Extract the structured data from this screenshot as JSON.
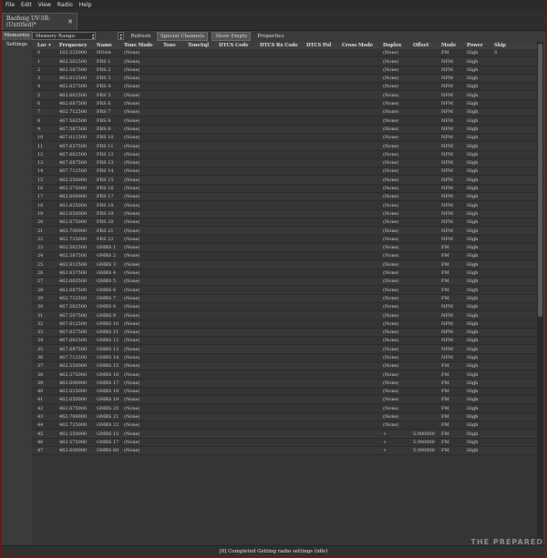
{
  "menu": [
    "File",
    "Edit",
    "View",
    "Radio",
    "Help"
  ],
  "doc_tab": {
    "title": "Baofeng UV-5R: (Untitled)*",
    "close": "✕"
  },
  "side_tabs": [
    "Memories",
    "Settings"
  ],
  "toolbar": {
    "memory_range": "Memory Range:",
    "refresh": "Refresh",
    "special_channels": "Special Channels",
    "show_empty": "Show Empty",
    "properties": "Properties"
  },
  "columns": [
    "Loc ▾",
    "Frequency",
    "Name",
    "Tone Mode",
    "Tone",
    "ToneSql",
    "DTCS Code",
    "DTCS Rx Code",
    "DTCS Pol",
    "Cross Mode",
    "Duplex",
    "Offset",
    "Mode",
    "Power",
    "Skip"
  ],
  "rows": [
    [
      "0",
      "162.525000",
      "NOAA",
      "(None)",
      "",
      "",
      "",
      "",
      "",
      "",
      "(None)",
      "",
      "FM",
      "High",
      "S"
    ],
    [
      "1",
      "462.562500",
      "FRS 1",
      "(None)",
      "",
      "",
      "",
      "",
      "",
      "",
      "(None)",
      "",
      "NFM",
      "High",
      ""
    ],
    [
      "2",
      "462.587500",
      "FRS 2",
      "(None)",
      "",
      "",
      "",
      "",
      "",
      "",
      "(None)",
      "",
      "NFM",
      "High",
      ""
    ],
    [
      "3",
      "462.612500",
      "FRS 3",
      "(None)",
      "",
      "",
      "",
      "",
      "",
      "",
      "(None)",
      "",
      "NFM",
      "High",
      ""
    ],
    [
      "4",
      "462.637500",
      "FRS 4",
      "(None)",
      "",
      "",
      "",
      "",
      "",
      "",
      "(None)",
      "",
      "NFM",
      "High",
      ""
    ],
    [
      "5",
      "462.662500",
      "FRS 5",
      "(None)",
      "",
      "",
      "",
      "",
      "",
      "",
      "(None)",
      "",
      "NFM",
      "High",
      ""
    ],
    [
      "6",
      "462.687500",
      "FRS 6",
      "(None)",
      "",
      "",
      "",
      "",
      "",
      "",
      "(None)",
      "",
      "NFM",
      "High",
      ""
    ],
    [
      "7",
      "462.712500",
      "FRS 7",
      "(None)",
      "",
      "",
      "",
      "",
      "",
      "",
      "(None)",
      "",
      "NFM",
      "High",
      ""
    ],
    [
      "8",
      "467.562500",
      "FRS 8",
      "(None)",
      "",
      "",
      "",
      "",
      "",
      "",
      "(None)",
      "",
      "NFM",
      "High",
      ""
    ],
    [
      "9",
      "467.587500",
      "FRS 9",
      "(None)",
      "",
      "",
      "",
      "",
      "",
      "",
      "(None)",
      "",
      "NFM",
      "High",
      ""
    ],
    [
      "10",
      "467.612500",
      "FRS 10",
      "(None)",
      "",
      "",
      "",
      "",
      "",
      "",
      "(None)",
      "",
      "NFM",
      "High",
      ""
    ],
    [
      "11",
      "467.637500",
      "FRS 11",
      "(None)",
      "",
      "",
      "",
      "",
      "",
      "",
      "(None)",
      "",
      "NFM",
      "High",
      ""
    ],
    [
      "12",
      "467.662500",
      "FRS 12",
      "(None)",
      "",
      "",
      "",
      "",
      "",
      "",
      "(None)",
      "",
      "NFM",
      "High",
      ""
    ],
    [
      "13",
      "467.687500",
      "FRS 13",
      "(None)",
      "",
      "",
      "",
      "",
      "",
      "",
      "(None)",
      "",
      "NFM",
      "High",
      ""
    ],
    [
      "14",
      "467.712500",
      "FRS 14",
      "(None)",
      "",
      "",
      "",
      "",
      "",
      "",
      "(None)",
      "",
      "NFM",
      "High",
      ""
    ],
    [
      "15",
      "462.550000",
      "FRS 15",
      "(None)",
      "",
      "",
      "",
      "",
      "",
      "",
      "(None)",
      "",
      "NFM",
      "High",
      ""
    ],
    [
      "16",
      "462.575000",
      "FRS 16",
      "(None)",
      "",
      "",
      "",
      "",
      "",
      "",
      "(None)",
      "",
      "NFM",
      "High",
      ""
    ],
    [
      "17",
      "462.600000",
      "FRS 17",
      "(None)",
      "",
      "",
      "",
      "",
      "",
      "",
      "(None)",
      "",
      "NFM",
      "High",
      ""
    ],
    [
      "18",
      "462.625000",
      "FRS 18",
      "(None)",
      "",
      "",
      "",
      "",
      "",
      "",
      "(None)",
      "",
      "NFM",
      "High",
      ""
    ],
    [
      "19",
      "462.650000",
      "FRS 19",
      "(None)",
      "",
      "",
      "",
      "",
      "",
      "",
      "(None)",
      "",
      "NFM",
      "High",
      ""
    ],
    [
      "20",
      "462.675000",
      "FRS 20",
      "(None)",
      "",
      "",
      "",
      "",
      "",
      "",
      "(None)",
      "",
      "NFM",
      "High",
      ""
    ],
    [
      "21",
      "462.700000",
      "FRS 21",
      "(None)",
      "",
      "",
      "",
      "",
      "",
      "",
      "(None)",
      "",
      "NFM",
      "High",
      ""
    ],
    [
      "22",
      "462.725000",
      "FRS 22",
      "(None)",
      "",
      "",
      "",
      "",
      "",
      "",
      "(None)",
      "",
      "NFM",
      "High",
      ""
    ],
    [
      "23",
      "462.562500",
      "GMRS 1",
      "(None)",
      "",
      "",
      "",
      "",
      "",
      "",
      "(None)",
      "",
      "FM",
      "High",
      ""
    ],
    [
      "24",
      "462.587500",
      "GMRS 2",
      "(None)",
      "",
      "",
      "",
      "",
      "",
      "",
      "(None)",
      "",
      "FM",
      "High",
      ""
    ],
    [
      "25",
      "462.612500",
      "GMRS 3",
      "(None)",
      "",
      "",
      "",
      "",
      "",
      "",
      "(None)",
      "",
      "FM",
      "High",
      ""
    ],
    [
      "26",
      "462.637500",
      "GMRS 4",
      "(None)",
      "",
      "",
      "",
      "",
      "",
      "",
      "(None)",
      "",
      "FM",
      "High",
      ""
    ],
    [
      "27",
      "462.662500",
      "GMRS 5",
      "(None)",
      "",
      "",
      "",
      "",
      "",
      "",
      "(None)",
      "",
      "FM",
      "High",
      ""
    ],
    [
      "28",
      "462.687500",
      "GMRS 6",
      "(None)",
      "",
      "",
      "",
      "",
      "",
      "",
      "(None)",
      "",
      "FM",
      "High",
      ""
    ],
    [
      "29",
      "462.712500",
      "GMRS 7",
      "(None)",
      "",
      "",
      "",
      "",
      "",
      "",
      "(None)",
      "",
      "FM",
      "High",
      ""
    ],
    [
      "30",
      "467.562500",
      "GMRS 8",
      "(None)",
      "",
      "",
      "",
      "",
      "",
      "",
      "(None)",
      "",
      "NFM",
      "High",
      ""
    ],
    [
      "31",
      "467.587500",
      "GMRS 9",
      "(None)",
      "",
      "",
      "",
      "",
      "",
      "",
      "(None)",
      "",
      "NFM",
      "High",
      ""
    ],
    [
      "32",
      "467.612500",
      "GMRS 10",
      "(None)",
      "",
      "",
      "",
      "",
      "",
      "",
      "(None)",
      "",
      "NFM",
      "High",
      ""
    ],
    [
      "33",
      "467.637500",
      "GMRS 11",
      "(None)",
      "",
      "",
      "",
      "",
      "",
      "",
      "(None)",
      "",
      "NFM",
      "High",
      ""
    ],
    [
      "34",
      "467.662500",
      "GMRS 12",
      "(None)",
      "",
      "",
      "",
      "",
      "",
      "",
      "(None)",
      "",
      "NFM",
      "High",
      ""
    ],
    [
      "35",
      "467.687500",
      "GMRS 13",
      "(None)",
      "",
      "",
      "",
      "",
      "",
      "",
      "(None)",
      "",
      "NFM",
      "High",
      ""
    ],
    [
      "36",
      "467.712500",
      "GMRS 14",
      "(None)",
      "",
      "",
      "",
      "",
      "",
      "",
      "(None)",
      "",
      "NFM",
      "High",
      ""
    ],
    [
      "37",
      "462.550000",
      "GMRS 15",
      "(None)",
      "",
      "",
      "",
      "",
      "",
      "",
      "(None)",
      "",
      "FM",
      "High",
      ""
    ],
    [
      "38",
      "462.575000",
      "GMRS 16",
      "(None)",
      "",
      "",
      "",
      "",
      "",
      "",
      "(None)",
      "",
      "FM",
      "High",
      ""
    ],
    [
      "39",
      "462.600000",
      "GMRS 17",
      "(None)",
      "",
      "",
      "",
      "",
      "",
      "",
      "(None)",
      "",
      "FM",
      "High",
      ""
    ],
    [
      "40",
      "462.625000",
      "GMRS 18",
      "(None)",
      "",
      "",
      "",
      "",
      "",
      "",
      "(None)",
      "",
      "FM",
      "High",
      ""
    ],
    [
      "41",
      "462.650000",
      "GMRS 19",
      "(None)",
      "",
      "",
      "",
      "",
      "",
      "",
      "(None)",
      "",
      "FM",
      "High",
      ""
    ],
    [
      "42",
      "462.675000",
      "GMRS 20",
      "(None)",
      "",
      "",
      "",
      "",
      "",
      "",
      "(None)",
      "",
      "FM",
      "High",
      ""
    ],
    [
      "43",
      "462.700000",
      "GMRS 21",
      "(None)",
      "",
      "",
      "",
      "",
      "",
      "",
      "(None)",
      "",
      "FM",
      "High",
      ""
    ],
    [
      "44",
      "462.725000",
      "GMRS 22",
      "(None)",
      "",
      "",
      "",
      "",
      "",
      "",
      "(None)",
      "",
      "FM",
      "High",
      ""
    ],
    [
      "45",
      "462.550000",
      "GMRS 15",
      "(None)",
      "",
      "",
      "",
      "",
      "",
      "",
      "+",
      "5.000000",
      "FM",
      "High",
      ""
    ],
    [
      "46",
      "462.575000",
      "GMRS 17",
      "(None)",
      "",
      "",
      "",
      "",
      "",
      "",
      "+",
      "5.000000",
      "FM",
      "High",
      ""
    ],
    [
      "47",
      "462.600000",
      "GMRS 60",
      "(None)",
      "",
      "",
      "",
      "",
      "",
      "",
      "+",
      "5.000000",
      "FM",
      "High",
      ""
    ]
  ],
  "status": "[0] Completed Getting radio settings (idle)",
  "watermark": "THE PREPARED"
}
